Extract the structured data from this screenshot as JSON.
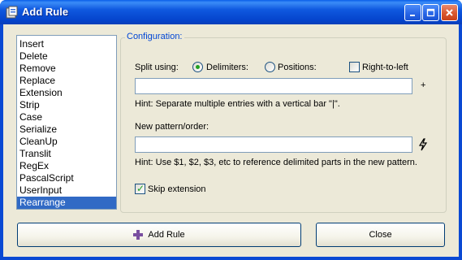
{
  "window": {
    "title": "Add Rule"
  },
  "rules": {
    "items": [
      "Insert",
      "Delete",
      "Remove",
      "Replace",
      "Extension",
      "Strip",
      "Case",
      "Serialize",
      "CleanUp",
      "Translit",
      "RegEx",
      "PascalScript",
      "UserInput",
      "Rearrange"
    ],
    "selected": "Rearrange"
  },
  "config": {
    "legend": "Configuration:",
    "split_label": "Split using:",
    "delimiters_label": "Delimiters:",
    "positions_label": "Positions:",
    "rtl_label": "Right-to-left",
    "split_value": "",
    "add_glyph": "+",
    "split_hint": "Hint: Separate multiple entries with a vertical bar \"|\".",
    "pattern_label": "New pattern/order:",
    "pattern_value": "",
    "pattern_hint": "Hint: Use $1, $2, $3, etc to reference delimited parts in the new pattern.",
    "skip_ext_label": "Skip extension"
  },
  "state": {
    "split_mode": "delimiters",
    "right_to_left": false,
    "skip_extension": true
  },
  "buttons": {
    "add": "Add Rule",
    "close": "Close"
  },
  "colors": {
    "accent": "#316ac5",
    "legend": "#0046d5",
    "titlebar": "#0a49d3",
    "check": "#21a121",
    "add_icon": "#7a4fa0"
  }
}
